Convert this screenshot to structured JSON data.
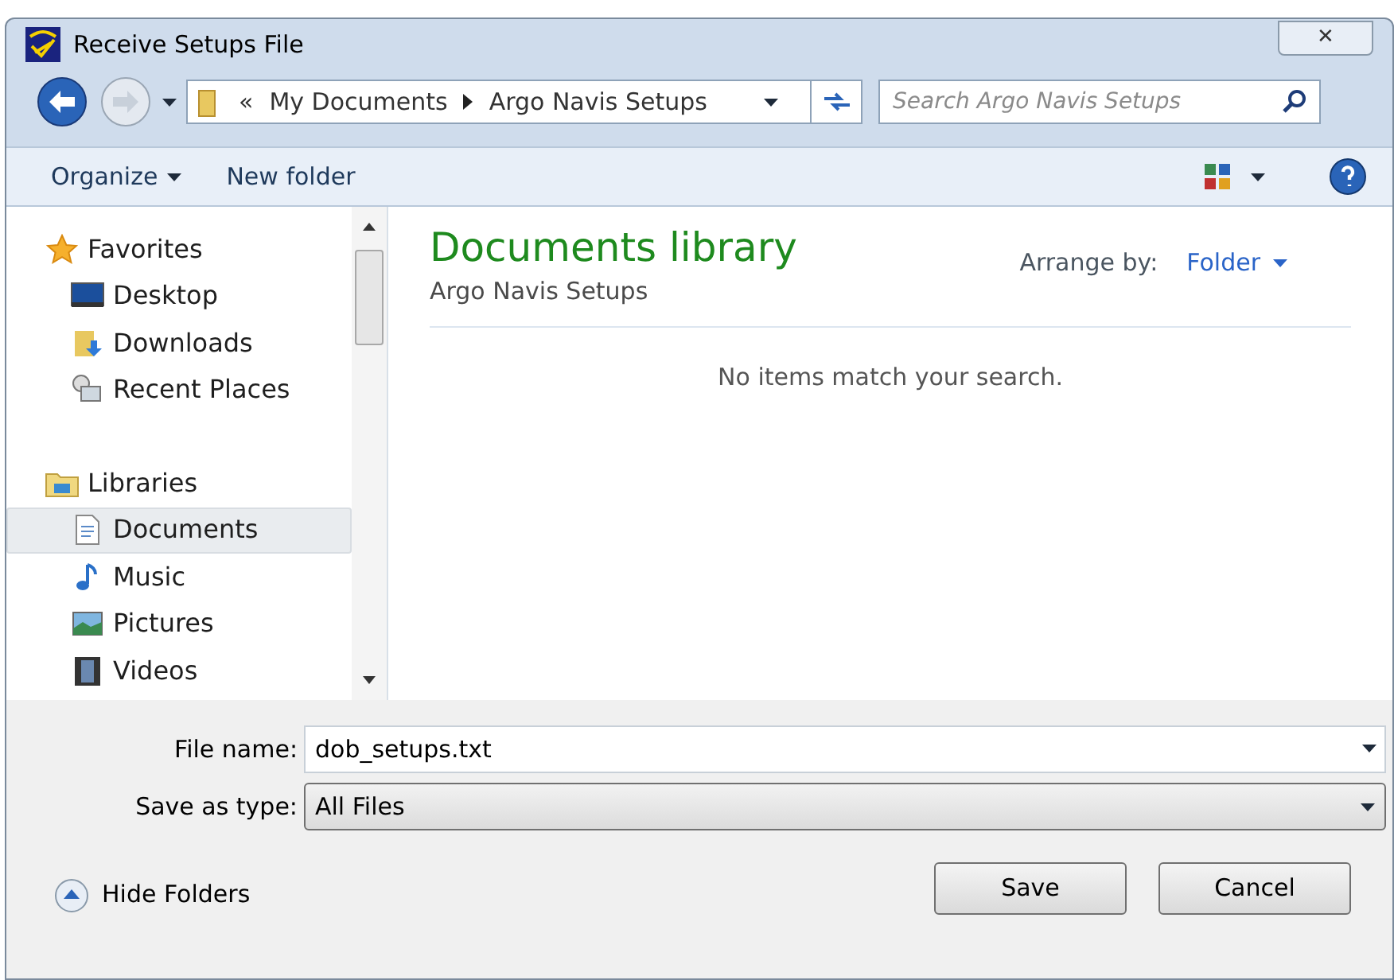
{
  "window": {
    "title": "Receive Setups File",
    "close": "✕"
  },
  "address": {
    "overflow": "«",
    "path": [
      {
        "label": "My Documents"
      },
      {
        "label": "Argo Navis Setups"
      }
    ]
  },
  "search": {
    "placeholder": "Search Argo Navis Setups"
  },
  "toolbar": {
    "organize": "Organize",
    "new_folder": "New folder"
  },
  "sidebar": {
    "groups": [
      {
        "label": "Favorites",
        "kind": "star",
        "children": [
          {
            "label": "Desktop",
            "kind": "desktop",
            "selected": false
          },
          {
            "label": "Downloads",
            "kind": "downloads",
            "selected": false
          },
          {
            "label": "Recent Places",
            "kind": "recent",
            "selected": false
          }
        ]
      },
      {
        "label": "Libraries",
        "kind": "libraries",
        "children": [
          {
            "label": "Documents",
            "kind": "documents",
            "selected": true
          },
          {
            "label": "Music",
            "kind": "music",
            "selected": false
          },
          {
            "label": "Pictures",
            "kind": "pictures",
            "selected": false
          },
          {
            "label": "Videos",
            "kind": "videos",
            "selected": false
          }
        ]
      }
    ]
  },
  "content": {
    "title": "Documents library",
    "subtitle": "Argo Navis Setups",
    "arrange_label": "Arrange by:",
    "arrange_value": "Folder",
    "empty": "No items match your search."
  },
  "form": {
    "file_name_label": "File name:",
    "file_name": "dob_setups.txt",
    "type_label": "Save as type:",
    "type": "All Files"
  },
  "footer": {
    "hide_folders": "Hide Folders",
    "save": "Save",
    "cancel": "Cancel"
  }
}
